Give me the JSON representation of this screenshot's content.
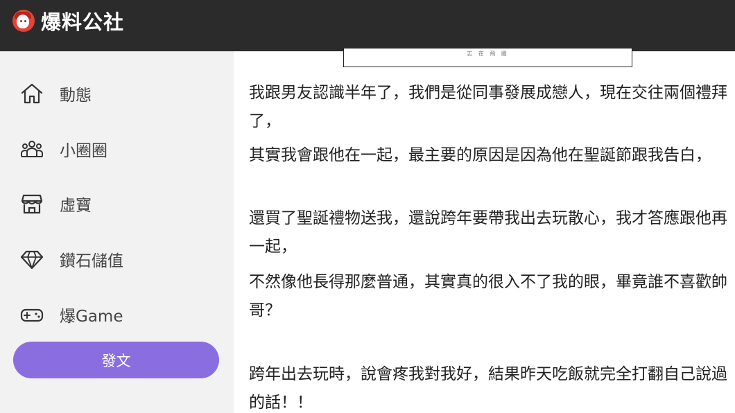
{
  "header": {
    "logo_text": "爆料公社",
    "logo_icon": "mascot-logo-icon",
    "background": "#2b2b2b"
  },
  "sidebar": {
    "items": [
      {
        "label": "動態",
        "icon": "home-icon"
      },
      {
        "label": "小圈圈",
        "icon": "group-icon"
      },
      {
        "label": "虛寶",
        "icon": "store-icon"
      },
      {
        "label": "鑽石儲值",
        "icon": "diamond-icon"
      },
      {
        "label": "爆Game",
        "icon": "gamepad-icon"
      }
    ],
    "post_button": "發文",
    "accent": "#8a6ee0"
  },
  "article": {
    "image_caption": "志 在 飛 躍",
    "paragraphs": [
      "我跟男友認識半年了，我們是從同事發展成戀人，現在交往兩個禮拜了，",
      "其實我會跟他在一起，最主要的原因是因為他在聖誕節跟我告白，",
      "還買了聖誕禮物送我，還說跨年要帶我出去玩散心，我才答應跟他再一起，",
      "不然像他長得那麼普通，其實真的很入不了我的眼，畢竟誰不喜歡帥哥？",
      "跨年出去玩時，說會疼我對我好，結果昨天吃飯就完全打翻自己說過的話！！"
    ]
  }
}
